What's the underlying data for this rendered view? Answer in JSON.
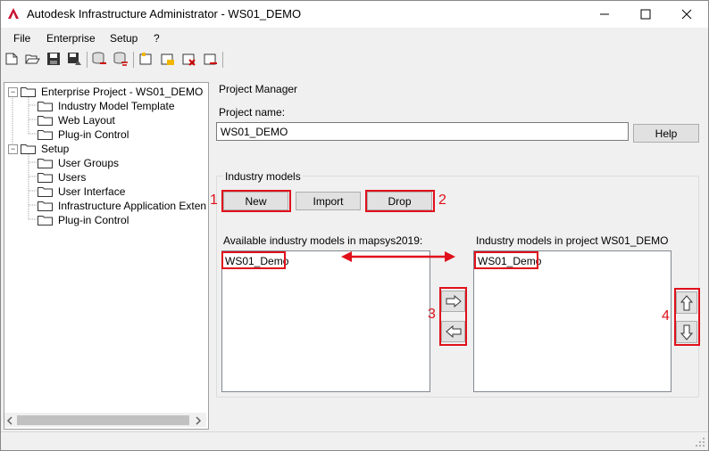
{
  "window": {
    "title": "Autodesk Infrastructure Administrator - WS01_DEMO"
  },
  "menu": [
    "File",
    "Enterprise",
    "Setup",
    "?"
  ],
  "toolbar_icons": [
    "new-file-icon",
    "open-folder-icon",
    "save-icon",
    "save-as-icon",
    "database-connect-icon",
    "database-disconnect-icon",
    "enterprise-new-icon",
    "enterprise-edit-icon",
    "enterprise-delete-icon",
    "enterprise-remove-icon"
  ],
  "tree": {
    "enterprise_label": "Enterprise Project - WS01_DEMO",
    "enterprise_children": [
      "Industry Model Template",
      "Web Layout",
      "Plug-in Control"
    ],
    "setup_label": "Setup",
    "setup_children": [
      "User Groups",
      "Users",
      "User Interface",
      "Infrastructure Application Extension",
      "Plug-in Control"
    ]
  },
  "panel": {
    "title": "Project Manager",
    "project_name_label": "Project name:",
    "project_name_value": "WS01_DEMO",
    "help_label": "Help",
    "group_title": "Industry models",
    "new_label": "New",
    "import_label": "Import",
    "drop_label": "Drop",
    "available_label": "Available industry models in mapsys2019:",
    "available_items": [
      "WS01_Demo"
    ],
    "project_models_label": "Industry models in project WS01_DEMO",
    "project_items": [
      "WS01_Demo"
    ]
  },
  "annotations": {
    "n1": "1",
    "n2": "2",
    "n3": "3",
    "n4": "4"
  },
  "colors": {
    "annotation_red": "#e0101b",
    "brand_red": "#c8102e"
  }
}
